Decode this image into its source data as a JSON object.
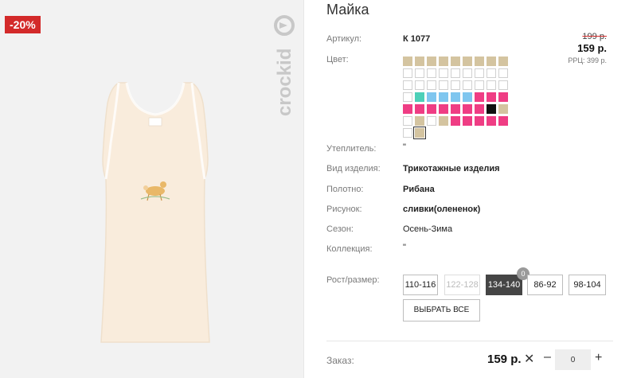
{
  "badge": {
    "discount": "-20%"
  },
  "brand": {
    "logo_text": "crockid"
  },
  "product": {
    "title": "Майка",
    "image_alt": "Майка"
  },
  "price": {
    "old": "199 р.",
    "current": "159 р.",
    "rrc": "РРЦ: 399 р."
  },
  "attributes": {
    "article_label": "Артикул:",
    "article_value": "К 1077",
    "color_label": "Цвет:",
    "insulation_label": "Утеплитель:",
    "insulation_value": "\"",
    "type_label": "Вид изделия:",
    "type_value": "Трикотажные изделия",
    "fabric_label": "Полотно:",
    "fabric_value": "Рибана",
    "print_label": "Рисунок:",
    "print_value": "сливки(олененок)",
    "season_label": "Сезон:",
    "season_value": "Осень-Зима",
    "collection_label": "Коллекция:",
    "collection_value": "\"",
    "size_label": "Рост/размер:"
  },
  "colors": {
    "beige": "#d4c4a0",
    "white": "#ffffff",
    "teal": "#4dd0b8",
    "sky": "#7fc6ef",
    "pink": "#ef3d84",
    "black": "#111111",
    "accent_red": "#d32a2a",
    "active_size": "#454545"
  },
  "swatches": [
    "beige",
    "beige",
    "beige",
    "beige",
    "beige",
    "beige",
    "beige",
    "beige",
    "beige",
    "white",
    "white",
    "white",
    "white",
    "white",
    "white",
    "white",
    "white",
    "white",
    "white",
    "white",
    "white",
    "white",
    "white",
    "white",
    "white",
    "white",
    "white",
    "white",
    "teal",
    "sky",
    "sky",
    "sky",
    "sky",
    "pink",
    "pink",
    "pink",
    "pink",
    "pink",
    "pink",
    "pink",
    "pink",
    "pink",
    "pink",
    "black",
    "beige",
    "white",
    "beige",
    "white",
    "beige",
    "pink",
    "pink",
    "pink",
    "pink",
    "pink",
    "white",
    "beige"
  ],
  "selected_swatch_index": 55,
  "sizes": [
    {
      "label": "110-116",
      "state": "normal"
    },
    {
      "label": "122-128",
      "state": "disabled"
    },
    {
      "label": "134-140",
      "state": "active"
    },
    {
      "label": "86-92",
      "state": "normal"
    },
    {
      "label": "98-104",
      "state": "normal"
    }
  ],
  "size_qty_badge": "0",
  "select_all_label": "ВЫБРАТЬ ВСЕ",
  "order": {
    "label": "Заказ:",
    "price": "159 р.",
    "remove_icon": "close-icon",
    "minus_icon": "minus-icon",
    "plus_icon": "plus-icon",
    "qty_value": "0"
  }
}
